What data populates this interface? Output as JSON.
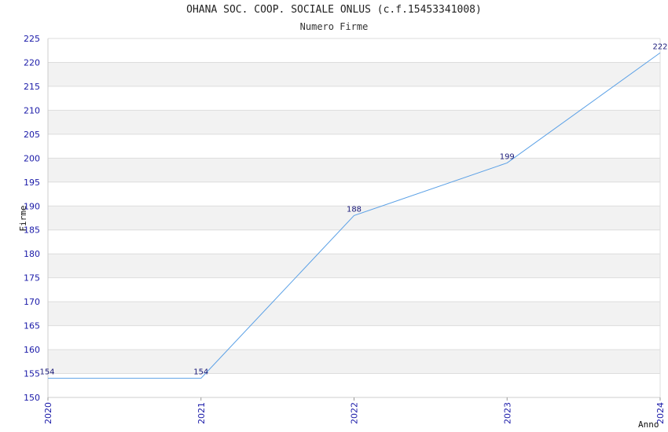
{
  "chart_data": {
    "type": "line",
    "title": "OHANA SOC. COOP. SOCIALE ONLUS (c.f.15453341008)",
    "subtitle": "Numero Firme",
    "xlabel": "Anno",
    "ylabel": "Firme",
    "x": [
      "2020",
      "2021",
      "2022",
      "2023",
      "2024"
    ],
    "series": [
      {
        "values": [
          154,
          154,
          188,
          199,
          222
        ]
      }
    ],
    "ylim": [
      150,
      225
    ],
    "ytick_step": 5,
    "grid": true,
    "line_color": "#5aa0e6",
    "band_color": "#f2f2f2",
    "tick_color": "#1a1aa8"
  }
}
